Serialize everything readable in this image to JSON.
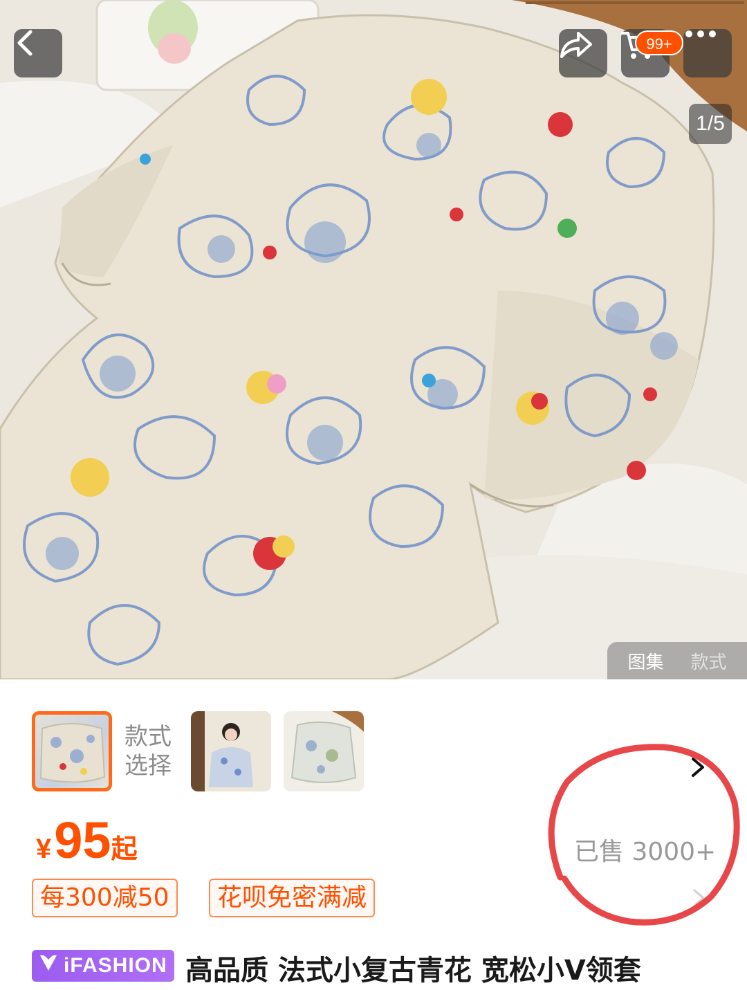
{
  "header": {
    "cart_badge": "99+",
    "page_indicator": "1/5",
    "icons": [
      "chevron-left-icon",
      "share-icon",
      "cart-icon",
      "more-icon"
    ]
  },
  "gallery_tabs": [
    "图集",
    "款式"
  ],
  "style_selector": {
    "label": "款式\n选择",
    "label_line1": "款式",
    "label_line2": "选择"
  },
  "price": {
    "currency": "¥",
    "amount": "95",
    "suffix": "起"
  },
  "sold": "已售 3000+",
  "coupons": [
    "每300减50",
    "花呗免密满减"
  ],
  "brand": {
    "name": "iFASHION"
  },
  "title": "高品质 法式小复古青花 宽松小V领套",
  "colors": {
    "accent": "#ff5000",
    "brand": "#a364f2",
    "annotation": "#e8474a"
  }
}
